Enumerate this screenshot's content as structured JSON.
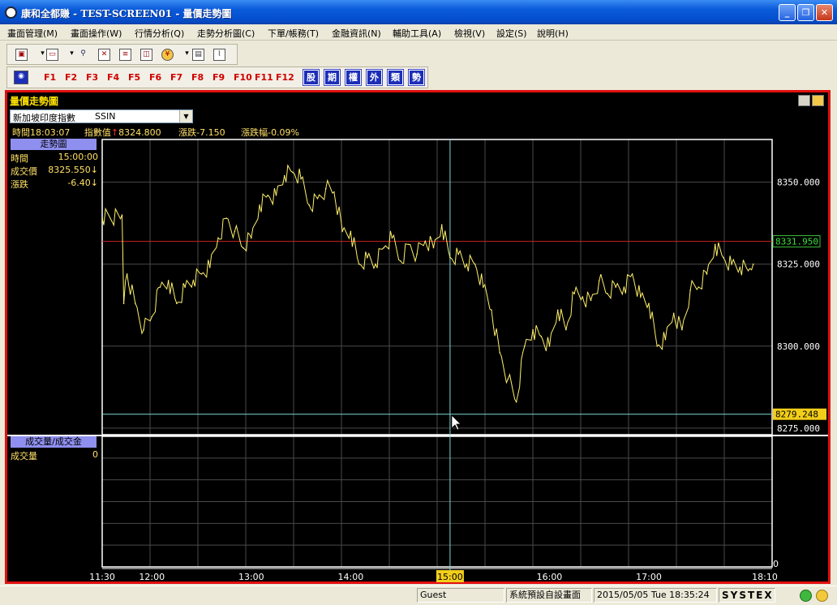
{
  "window": {
    "title": "康和全都賺 - TEST-SCREEN01 - 量價走勢圖",
    "minimize": "_",
    "maximize": "❐",
    "close": "✕"
  },
  "menu": [
    "畫面管理(M)",
    "畫面操作(W)",
    "行情分析(Q)",
    "走勢分析圖(C)",
    "下單/帳務(T)",
    "金融資訊(N)",
    "輔助工具(A)",
    "檢視(V)",
    "設定(S)",
    "說明(H)"
  ],
  "fkeys": [
    "F1",
    "F2",
    "F3",
    "F4",
    "F5",
    "F6",
    "F7",
    "F8",
    "F9",
    "F10",
    "F11",
    "F12"
  ],
  "kind_buttons": [
    "股",
    "期",
    "權",
    "外",
    "類",
    "勢"
  ],
  "panel": {
    "title": "量價走勢圖",
    "instrument_name": "新加坡印度指數",
    "instrument_code": "SSIN",
    "info": {
      "time_label": "時間18:03:07",
      "index_label": "指數值",
      "index_value": "8324.800",
      "change": "漲跌-7.150",
      "change_pct": "漲跌幅-0.09%"
    },
    "price_panel": {
      "header": "走勢圖",
      "rows": [
        {
          "label": "時間",
          "value": "15:00:00"
        },
        {
          "label": "成交價",
          "value": "8325.550↓"
        },
        {
          "label": "漲跌",
          "value": "-6.40↓"
        }
      ]
    },
    "volume_panel": {
      "header": "成交量/成交金",
      "rows": [
        {
          "label": "成交量",
          "value": "0"
        }
      ]
    }
  },
  "chart_data": {
    "type": "line",
    "x_ticks": [
      "11:30",
      "12:00",
      "13:00",
      "14:00",
      "15:00",
      "16:00",
      "17:00",
      "18:10"
    ],
    "y_ticks": [
      8350.0,
      8325.0,
      8300.0,
      8275.0
    ],
    "y_tick_labels": [
      "8350.000",
      "8325.000",
      "8300.000",
      "8275.000"
    ],
    "ylim": [
      8273,
      8363
    ],
    "reference_line": {
      "value": 8331.95,
      "label": "8331.950",
      "color": "#CC2222"
    },
    "cursor_line": {
      "value": 8279.248,
      "label": "8279.248"
    },
    "cursor_time": "15:00",
    "volume_axis_label": "0",
    "x": [
      "11:30",
      "11:42",
      "11:43",
      "11:45",
      "11:50",
      "11:55",
      "12:00",
      "12:05",
      "12:10",
      "12:15",
      "12:20",
      "12:25",
      "12:30",
      "12:35",
      "12:40",
      "12:45",
      "12:50",
      "12:55",
      "13:00",
      "13:05",
      "13:10",
      "13:15",
      "13:20",
      "13:25",
      "13:30",
      "13:35",
      "13:40",
      "13:45",
      "13:50",
      "13:55",
      "14:00",
      "14:05",
      "14:10",
      "14:15",
      "14:20",
      "14:25",
      "14:30",
      "14:35",
      "14:40",
      "14:45",
      "14:50",
      "14:55",
      "15:00",
      "15:05",
      "15:10",
      "15:15",
      "15:20",
      "15:25",
      "15:30",
      "15:35",
      "15:40",
      "15:45",
      "15:50",
      "15:55",
      "16:00",
      "16:05",
      "16:10",
      "16:15",
      "16:20",
      "16:25",
      "16:30",
      "16:35",
      "16:40",
      "16:45",
      "16:50",
      "16:55",
      "17:00",
      "17:05",
      "17:10",
      "17:15",
      "17:20",
      "17:25",
      "17:30",
      "17:35",
      "17:40",
      "17:45",
      "17:50",
      "17:55",
      "18:00",
      "18:03"
    ],
    "values": [
      8339,
      8340,
      8313,
      8322,
      8313,
      8305,
      8309,
      8318,
      8320,
      8313,
      8318,
      8320,
      8322,
      8324,
      8333,
      8339,
      8335,
      8330,
      8333,
      8343,
      8346,
      8346,
      8352,
      8353,
      8351,
      8343,
      8345,
      8348,
      8347,
      8335,
      8335,
      8325,
      8327,
      8325,
      8330,
      8333,
      8326,
      8331,
      8328,
      8332,
      8330,
      8337,
      8327,
      8328,
      8325,
      8325,
      8318,
      8311,
      8298,
      8290,
      8283,
      8300,
      8305,
      8303,
      8300,
      8311,
      8305,
      8316,
      8315,
      8314,
      8320,
      8316,
      8318,
      8318,
      8322,
      8315,
      8313,
      8300,
      8302,
      8310,
      8305,
      8317,
      8318,
      8322,
      8331,
      8327,
      8325,
      8324,
      8323,
      8325
    ]
  },
  "status_bar": {
    "user": "Guest",
    "layout": "系統預設自設畫面",
    "datetime": "2015/05/05 Tue 18:35:24",
    "brand": "SYSTEX"
  },
  "colors": {
    "line": "#FFF06A",
    "grid": "#4A4A4A",
    "axis": "#FFFFFF",
    "cursor": "#7FD6D6",
    "frame": "#E01010"
  }
}
